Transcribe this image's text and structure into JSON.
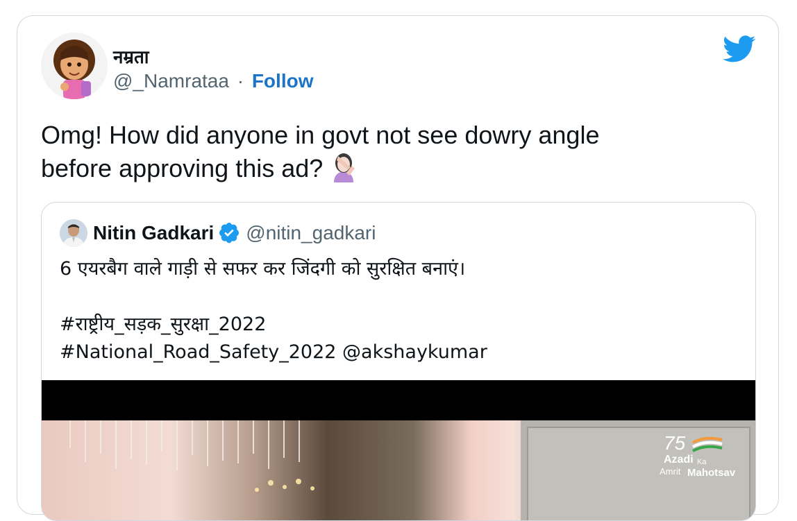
{
  "author": {
    "name": "नम्रता",
    "handle": "@_Namrataa",
    "separator": "·",
    "follow_label": "Follow"
  },
  "tweet": {
    "line1": "Omg! How did anyone in govt not see dowry angle",
    "line2": "before approving this ad?",
    "emoji": "woman-facepalming-emoji"
  },
  "quoted": {
    "name": "Nitin Gadkari",
    "handle": "@nitin_gadkari",
    "verified": true,
    "text_line1": "6 एयरबैग वाले गाड़ी से सफर कर जिंदगी को सुरक्षित बनाएं।",
    "text_line2": "",
    "hashtag1": "#राष्ट्रीय_सड़क_सुरक्षा_2022",
    "hashtag2_and_mention": "#National_Road_Safety_2022 @akshaykumar"
  },
  "media": {
    "watermark_number": "75",
    "watermark_line1": "Azadi",
    "watermark_ka": "Ka",
    "watermark_amrit": "Amrit",
    "watermark_mahotsav": "Mahotsav"
  },
  "colors": {
    "twitter_blue": "#1d9bf0",
    "follow_blue": "#1d74c7",
    "border": "#cfd9de",
    "muted_text": "#536471"
  },
  "icons": [
    "twitter-bird-icon",
    "verified-badge-icon"
  ]
}
